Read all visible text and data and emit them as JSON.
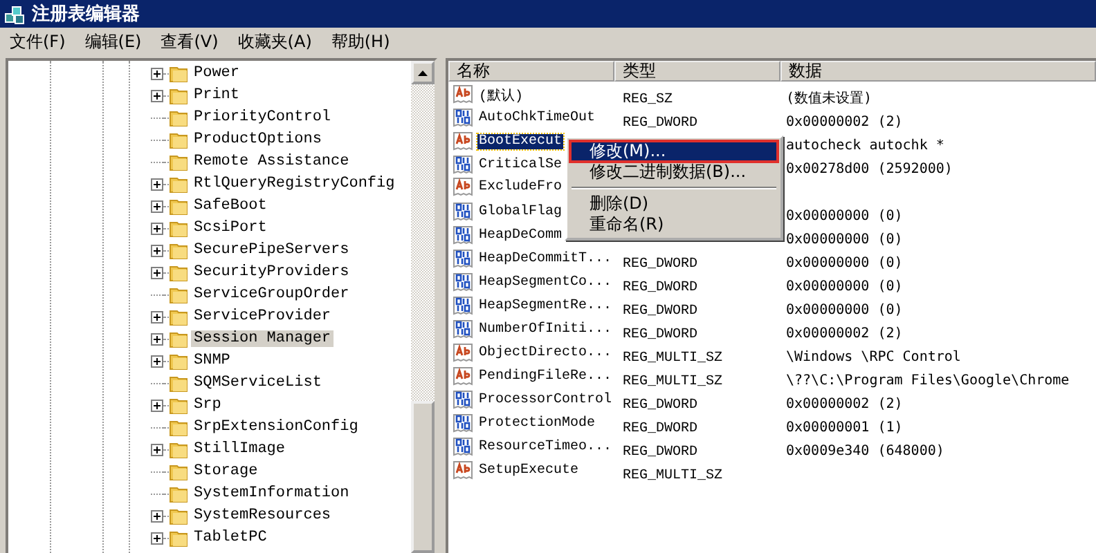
{
  "window": {
    "title": "注册表编辑器"
  },
  "menu": [
    "文件(F)",
    "编辑(E)",
    "查看(V)",
    "收藏夹(A)",
    "帮助(H)"
  ],
  "tree": {
    "items": [
      {
        "label": "Power",
        "has_children": true,
        "selected": false
      },
      {
        "label": "Print",
        "has_children": true,
        "selected": false
      },
      {
        "label": "PriorityControl",
        "has_children": false,
        "selected": false
      },
      {
        "label": "ProductOptions",
        "has_children": false,
        "selected": false
      },
      {
        "label": "Remote Assistance",
        "has_children": false,
        "selected": false
      },
      {
        "label": "RtlQueryRegistryConfig",
        "has_children": true,
        "selected": false
      },
      {
        "label": "SafeBoot",
        "has_children": true,
        "selected": false
      },
      {
        "label": "ScsiPort",
        "has_children": true,
        "selected": false
      },
      {
        "label": "SecurePipeServers",
        "has_children": true,
        "selected": false
      },
      {
        "label": "SecurityProviders",
        "has_children": true,
        "selected": false
      },
      {
        "label": "ServiceGroupOrder",
        "has_children": false,
        "selected": false
      },
      {
        "label": "ServiceProvider",
        "has_children": true,
        "selected": false
      },
      {
        "label": "Session Manager",
        "has_children": true,
        "selected": true
      },
      {
        "label": "SNMP",
        "has_children": true,
        "selected": false
      },
      {
        "label": "SQMServiceList",
        "has_children": false,
        "selected": false
      },
      {
        "label": "Srp",
        "has_children": true,
        "selected": false
      },
      {
        "label": "SrpExtensionConfig",
        "has_children": false,
        "selected": false
      },
      {
        "label": "StillImage",
        "has_children": true,
        "selected": false
      },
      {
        "label": "Storage",
        "has_children": false,
        "selected": false
      },
      {
        "label": "SystemInformation",
        "has_children": false,
        "selected": false
      },
      {
        "label": "SystemResources",
        "has_children": true,
        "selected": false
      },
      {
        "label": "TabletPC",
        "has_children": true,
        "selected": false
      }
    ]
  },
  "values": {
    "columns": [
      "名称",
      "类型",
      "数据"
    ],
    "rows": [
      {
        "kind": "string",
        "name": "(默认)",
        "type": "REG_SZ",
        "data": "(数值未设置)",
        "selected": false
      },
      {
        "kind": "dword",
        "name": "AutoChkTimeOut",
        "type": "REG_DWORD",
        "data": "0x00000002 (2)",
        "selected": false
      },
      {
        "kind": "string",
        "name": "BootExecut",
        "data": "autocheck autochk *",
        "selected": true
      },
      {
        "kind": "dword",
        "name": "CriticalSe",
        "data": "0x00278d00 (2592000)",
        "selected": false
      },
      {
        "kind": "string",
        "name": "ExcludeFro",
        "selected": false
      },
      {
        "kind": "dword",
        "name": "GlobalFlag",
        "data": "0x00000000 (0)",
        "selected": false
      },
      {
        "kind": "dword",
        "name": "HeapDeComm",
        "data": "0x00000000 (0)",
        "selected": false
      },
      {
        "kind": "dword",
        "name": "HeapDeCommitT...",
        "type": "REG_DWORD",
        "data": "0x00000000 (0)",
        "selected": false
      },
      {
        "kind": "dword",
        "name": "HeapSegmentCo...",
        "type": "REG_DWORD",
        "data": "0x00000000 (0)",
        "selected": false
      },
      {
        "kind": "dword",
        "name": "HeapSegmentRe...",
        "type": "REG_DWORD",
        "data": "0x00000000 (0)",
        "selected": false
      },
      {
        "kind": "dword",
        "name": "NumberOfIniti...",
        "type": "REG_DWORD",
        "data": "0x00000002 (2)",
        "selected": false
      },
      {
        "kind": "string",
        "name": "ObjectDirecto...",
        "type": "REG_MULTI_SZ",
        "data": "\\Windows \\RPC Control",
        "selected": false
      },
      {
        "kind": "string",
        "name": "PendingFileRe...",
        "type": "REG_MULTI_SZ",
        "data": "\\??\\C:\\Program Files\\Google\\Chrome",
        "selected": false
      },
      {
        "kind": "dword",
        "name": "ProcessorControl",
        "type": "REG_DWORD",
        "data": "0x00000002 (2)",
        "selected": false
      },
      {
        "kind": "dword",
        "name": "ProtectionMode",
        "type": "REG_DWORD",
        "data": "0x00000001 (1)",
        "selected": false
      },
      {
        "kind": "dword",
        "name": "ResourceTimeo...",
        "type": "REG_DWORD",
        "data": "0x0009e340 (648000)",
        "selected": false
      },
      {
        "kind": "string",
        "name": "SetupExecute",
        "type": "REG_MULTI_SZ",
        "selected": false
      }
    ]
  },
  "context_menu": {
    "items": [
      {
        "kind": "item",
        "label": "修改(M)...",
        "selected": true,
        "highlighted": true
      },
      {
        "kind": "item",
        "label": "修改二进制数据(B)...",
        "selected": false,
        "highlighted": false
      },
      {
        "kind": "separator"
      },
      {
        "kind": "item",
        "label": "删除(D)",
        "selected": false,
        "highlighted": false
      },
      {
        "kind": "item",
        "label": "重命名(R)",
        "selected": false,
        "highlighted": false
      }
    ]
  }
}
